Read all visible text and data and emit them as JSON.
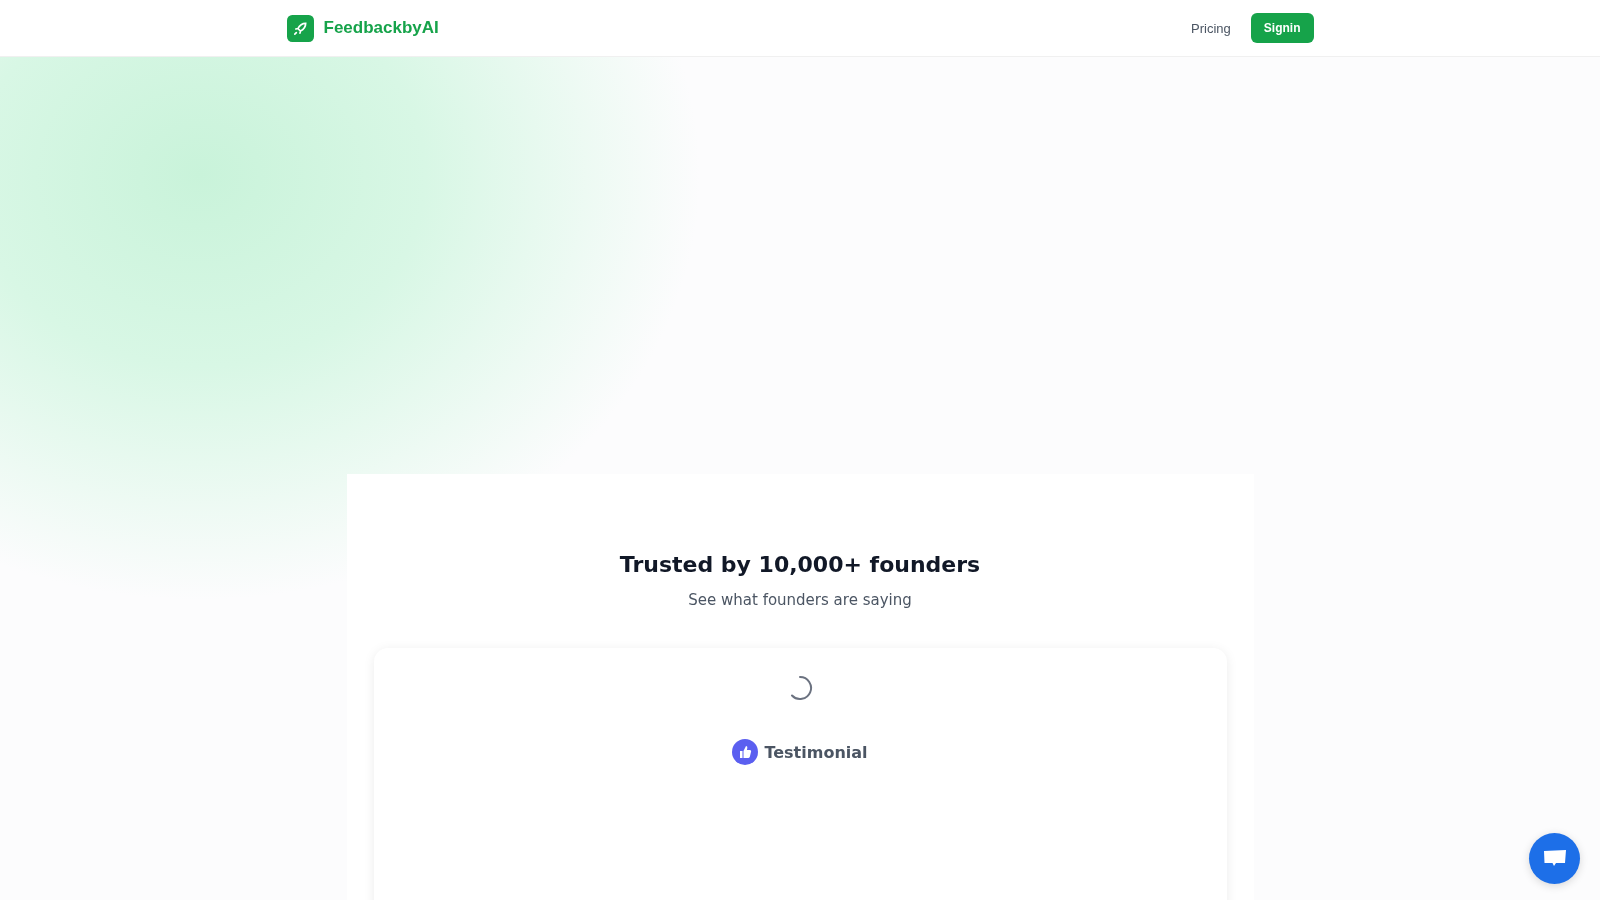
{
  "header": {
    "brand": "FeedbackbyAI",
    "nav": [
      {
        "label": "Pricing",
        "kind": "link"
      },
      {
        "label": "Signin",
        "kind": "button"
      }
    ]
  },
  "testimonials": {
    "title": "Trusted by 10,000+ founders",
    "subtitle": "See what founders are saying",
    "card": {
      "loading": true,
      "label": "Testimonial"
    }
  }
}
